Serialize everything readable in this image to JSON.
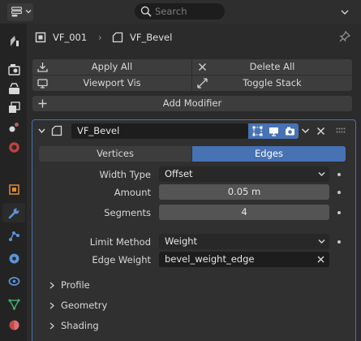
{
  "header": {
    "editor_type_icon": "properties-editor-icon",
    "search_placeholder": "Search"
  },
  "tabs": [
    {
      "name": "tool-tab",
      "icon": "tool-icon"
    },
    {
      "name": "render-tab",
      "icon": "render-icon"
    },
    {
      "name": "output-tab",
      "icon": "output-icon"
    },
    {
      "name": "view-layer-tab",
      "icon": "view-layer-icon"
    },
    {
      "name": "scene-tab",
      "icon": "scene-icon"
    },
    {
      "name": "world-tab",
      "icon": "world-icon"
    },
    {
      "name": "object-tab",
      "icon": "object-icon"
    },
    {
      "name": "modifiers-tab",
      "icon": "wrench-icon",
      "active": true
    },
    {
      "name": "particles-tab",
      "icon": "particles-icon"
    },
    {
      "name": "physics-tab",
      "icon": "physics-icon"
    },
    {
      "name": "constraints-tab",
      "icon": "constraints-icon"
    },
    {
      "name": "data-tab",
      "icon": "mesh-data-icon"
    },
    {
      "name": "material-tab",
      "icon": "material-icon"
    }
  ],
  "breadcrumb": {
    "object_name": "VF_001",
    "separator": "›",
    "modifier_name": "VF_Bevel"
  },
  "toolbar": {
    "apply_all": "Apply All",
    "delete_all": "Delete All",
    "viewport_vis": "Viewport Vis",
    "toggle_stack": "Toggle Stack",
    "add_modifier": "Add Modifier"
  },
  "modifier": {
    "name": "VF_Bevel",
    "affect_options": [
      "Vertices",
      "Edges"
    ],
    "affect_selected": "Edges",
    "width_type_label": "Width Type",
    "width_type_value": "Offset",
    "amount_label": "Amount",
    "amount_value": "0.05 m",
    "segments_label": "Segments",
    "segments_value": "4",
    "limit_method_label": "Limit Method",
    "limit_method_value": "Weight",
    "edge_weight_label": "Edge Weight",
    "edge_weight_value": "bevel_weight_edge",
    "subpanels": [
      "Profile",
      "Geometry",
      "Shading"
    ]
  },
  "colors": {
    "accent": "#4772b3",
    "panel_bg": "#303030",
    "window_bg": "#2b2b2b"
  }
}
